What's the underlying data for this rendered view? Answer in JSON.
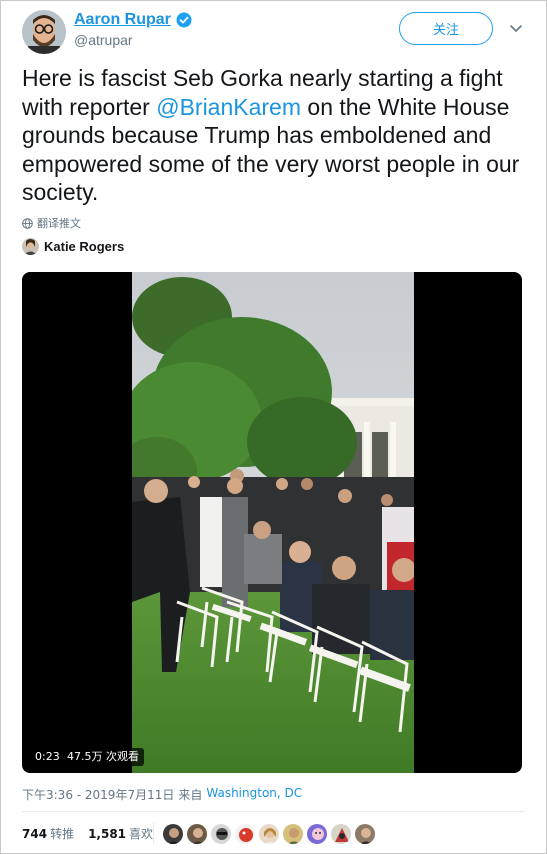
{
  "author": {
    "name": "Aaron Rupar",
    "handle": "@atrupar",
    "avatar_icon": "bearded-man-with-glasses-avatar",
    "verified": true
  },
  "follow": {
    "label": "关注"
  },
  "tweet": {
    "text_before": "Here is fascist Seb Gorka nearly starting a fight with reporter ",
    "mention": "@BrianKarem",
    "text_after": " on the White House grounds because Trump has emboldened and empowered some of the very worst people in our society."
  },
  "translate": {
    "label": "翻译推文",
    "icon": "globe-icon"
  },
  "tagged": {
    "name": "Katie Rogers",
    "icon": "person-avatar"
  },
  "video": {
    "duration": "0:23",
    "views": "47.5万 次观看"
  },
  "meta": {
    "datetime": "下午3:36 - 2019年7月11日",
    "from": "来自",
    "location": "Washington, DC"
  },
  "stats": {
    "retweets": "744",
    "retweets_label": "转推",
    "likes": "1,581",
    "likes_label": "喜欢"
  },
  "likers": [
    "liker-avatar-1",
    "liker-avatar-2",
    "liker-avatar-3",
    "liker-avatar-4",
    "liker-avatar-5",
    "liker-avatar-6",
    "liker-avatar-7",
    "liker-avatar-8",
    "liker-avatar-9"
  ],
  "colors": {
    "accent": "#1b95e0",
    "text": "#14171a",
    "muted": "#657786"
  }
}
